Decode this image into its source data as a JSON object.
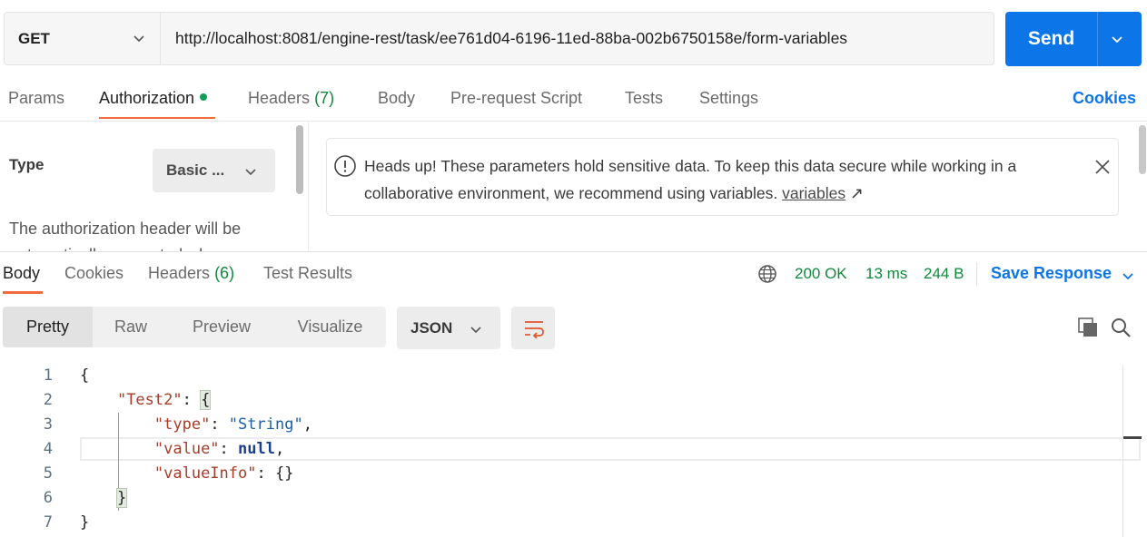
{
  "request": {
    "method": "GET",
    "url": "http://localhost:8081/engine-rest/task/ee761d04-6196-11ed-88ba-002b6750158e/form-variables",
    "send_label": "Send"
  },
  "request_tabs": {
    "params": "Params",
    "authorization": "Authorization",
    "headers": "Headers",
    "headers_count": "(7)",
    "body": "Body",
    "prerequest": "Pre-request Script",
    "tests": "Tests",
    "settings": "Settings",
    "cookies": "Cookies"
  },
  "auth": {
    "type_label": "Type",
    "type_value": "Basic ...",
    "description": "The authorization header will be automatically generated when"
  },
  "notice": {
    "text": "Heads up! These parameters hold sensitive data. To keep this data secure while working in a collaborative environment, we recommend using variables.",
    "link": "variables",
    "link_arrow": "↗"
  },
  "response_tabs": {
    "body": "Body",
    "cookies": "Cookies",
    "headers": "Headers",
    "headers_count": "(6)",
    "test_results": "Test Results"
  },
  "response_meta": {
    "status": "200 OK",
    "time": "13 ms",
    "size": "244 B",
    "save_response": "Save Response"
  },
  "view": {
    "pretty": "Pretty",
    "raw": "Raw",
    "preview": "Preview",
    "visualize": "Visualize",
    "format": "JSON"
  },
  "code": {
    "line_numbers": [
      "1",
      "2",
      "3",
      "4",
      "5",
      "6",
      "7"
    ],
    "open_brace": "{",
    "test2_key": "\"Test2\"",
    "type_key": "\"type\"",
    "type_value": "\"String\"",
    "value_key": "\"value\"",
    "value_value": "null",
    "valueinfo_key": "\"valueInfo\"",
    "valueinfo_value": "{}",
    "inner_close": "}",
    "close_brace": "}"
  },
  "colors": {
    "accent_blue": "#0c75e8",
    "accent_orange": "#f26b3a",
    "status_green": "#0f8a3c"
  }
}
